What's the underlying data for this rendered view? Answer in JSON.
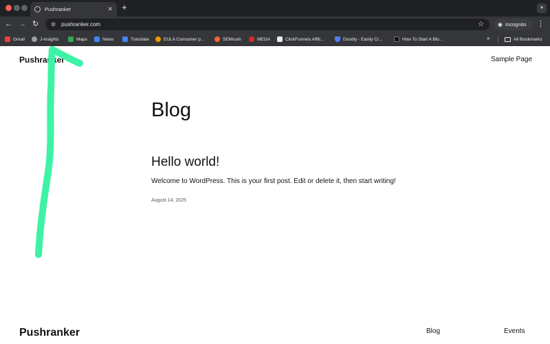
{
  "browser": {
    "tab": {
      "title": "Pushranker"
    },
    "address_bar": {
      "url": "pushranker.com"
    },
    "profile_label": "Incognito",
    "bookmarks": [
      {
        "label": "Gmail",
        "icon": "gmail-icon",
        "color": "#ea4335"
      },
      {
        "label": "J-insights",
        "icon": "globe-icon",
        "color": "#9aa0a6"
      },
      {
        "label": "Maps",
        "icon": "maps-icon",
        "color": "#34a853"
      },
      {
        "label": "News",
        "icon": "news-icon",
        "color": "#4285f4"
      },
      {
        "label": "Translate",
        "icon": "translate-icon",
        "color": "#4285f4"
      },
      {
        "label": "EULA Consumer p...",
        "icon": "eula-icon",
        "color": "#f29900"
      },
      {
        "label": "SEMrush",
        "icon": "semrush-icon",
        "color": "#ff642d"
      },
      {
        "label": "MEGA",
        "icon": "mega-icon",
        "color": "#d9272e"
      },
      {
        "label": "ClickFunnels Affili...",
        "icon": "clickfunnels-icon",
        "color": "#e8eaed"
      },
      {
        "label": "Doodly - Easily Cr...",
        "icon": "doodly-icon",
        "color": "#4f7cff"
      },
      {
        "label": "How To Start A Blo...",
        "icon": "medium-icon",
        "color": "#111111"
      }
    ],
    "all_bookmarks_label": "All Bookmarks"
  },
  "page": {
    "site_title": "Pushranker",
    "nav_link": "Sample Page",
    "heading": "Blog",
    "posts": [
      {
        "title": "Hello world!",
        "excerpt": "Welcome to WordPress. This is your first post. Edit or delete it, then start writing!",
        "date": "August 14, 2025"
      }
    ],
    "footer": {
      "site_title": "Pushranker",
      "links": [
        "Blog",
        "Events"
      ]
    }
  },
  "annotation": {
    "color": "#3ef2a6",
    "shape": "arrow-up"
  }
}
